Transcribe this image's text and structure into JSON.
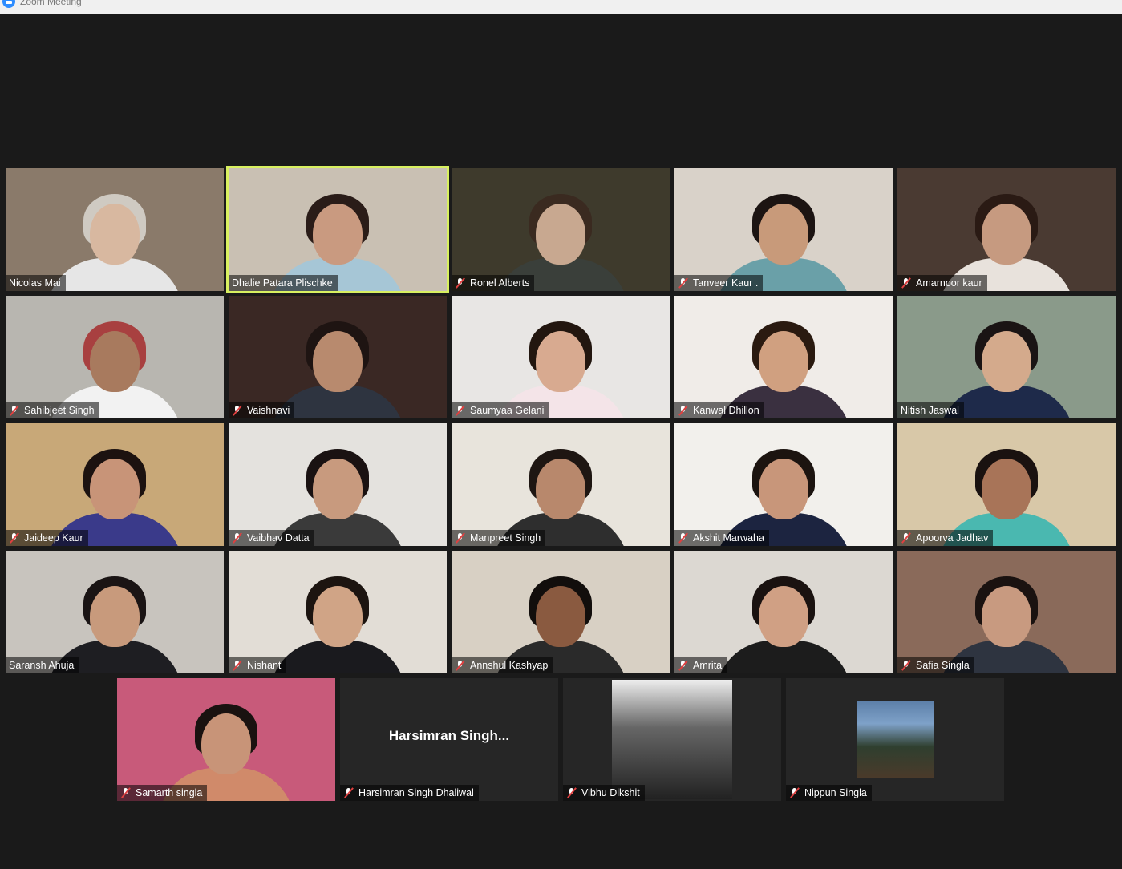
{
  "window": {
    "title": "Zoom Meeting",
    "app_icon": "zoom-icon"
  },
  "participants": [
    {
      "name": "Nicolas Mai",
      "muted": false,
      "bg": "#8a7a6a",
      "skin": "#d8b8a0",
      "hair": "#cfcac2",
      "shirt": "#e6e6e6"
    },
    {
      "name": "Dhalie Patara Plischke",
      "muted": false,
      "active": true,
      "bg": "#c9c0b3",
      "skin": "#c99a80",
      "hair": "#2a1c18",
      "shirt": "#a6c6d6"
    },
    {
      "name": "Ronel Alberts",
      "muted": true,
      "bg": "#3e3a2c",
      "skin": "#c8a890",
      "hair": "#3a2a20",
      "shirt": "#3a3f3a"
    },
    {
      "name": "Tanveer Kaur .",
      "muted": true,
      "bg": "#d9d2c9",
      "skin": "#c89a7a",
      "hair": "#1c1412",
      "shirt": "#6aa0a8"
    },
    {
      "name": "Amarnoor kaur",
      "muted": true,
      "bg": "#4a3a32",
      "skin": "#c69a80",
      "hair": "#2a1a14",
      "shirt": "#e8e2dc"
    },
    {
      "name": "Sahibjeet Singh",
      "muted": true,
      "bg": "#b8b6b0",
      "skin": "#a87a5e",
      "hair": "#a84040",
      "shirt": "#f2f2f2"
    },
    {
      "name": "Vaishnavi",
      "muted": true,
      "bg": "#3a2824",
      "skin": "#b88a6e",
      "hair": "#1e1412",
      "shirt": "#2e3440"
    },
    {
      "name": "Saumyaa Gelani",
      "muted": true,
      "bg": "#e8e6e4",
      "skin": "#d8aa90",
      "hair": "#22160f",
      "shirt": "#f4e4e8"
    },
    {
      "name": "Kanwal Dhillon",
      "muted": true,
      "bg": "#f0ece8",
      "skin": "#d0a080",
      "hair": "#2a1a10",
      "shirt": "#3a3040"
    },
    {
      "name": "Nitish Jaswal",
      "muted": false,
      "bg": "#8a9a8a",
      "skin": "#d4aa8c",
      "hair": "#1a1414",
      "shirt": "#1e2a4a"
    },
    {
      "name": "Jaideep Kaur",
      "muted": true,
      "bg": "#c8a878",
      "skin": "#c89478",
      "hair": "#1c1210",
      "shirt": "#3a3a8a"
    },
    {
      "name": "Vaibhav Datta",
      "muted": true,
      "bg": "#e4e2de",
      "skin": "#c89a7e",
      "hair": "#1a1212",
      "shirt": "#3a3a3a"
    },
    {
      "name": "Manpreet Singh",
      "muted": true,
      "bg": "#e8e4dc",
      "skin": "#b8886c",
      "hair": "#1e1612",
      "shirt": "#2e2e2e"
    },
    {
      "name": "Akshit Marwaha",
      "muted": true,
      "bg": "#f2f0ec",
      "skin": "#c8967a",
      "hair": "#1c1410",
      "shirt": "#1c2440"
    },
    {
      "name": "Apoorva Jadhav",
      "muted": true,
      "bg": "#d8c8a8",
      "skin": "#a87458",
      "hair": "#1a1210",
      "shirt": "#4ab8b0"
    },
    {
      "name": "Saransh Ahuja",
      "muted": false,
      "bg": "#c8c4be",
      "skin": "#c89a7c",
      "hair": "#1a1414",
      "shirt": "#1e1e22"
    },
    {
      "name": "Nishant",
      "muted": true,
      "bg": "#e2ddd6",
      "skin": "#d0a486",
      "hair": "#1c1410",
      "shirt": "#1a1a1e"
    },
    {
      "name": "Annshul Kashyap",
      "muted": true,
      "bg": "#d8d0c4",
      "skin": "#8a5a40",
      "hair": "#120e0c",
      "shirt": "#2a2a2a"
    },
    {
      "name": "Amrita",
      "muted": true,
      "bg": "#dcd8d2",
      "skin": "#d0a084",
      "hair": "#1a1210",
      "shirt": "#1c1c1c"
    },
    {
      "name": "Safia Singla",
      "muted": true,
      "bg": "#8a6a5a",
      "skin": "#c89a80",
      "hair": "#1a1210",
      "shirt": "#2e3440"
    }
  ],
  "bottom_row": [
    {
      "name": "Samarth singla",
      "muted": true,
      "type": "video",
      "bg": "#c85a7a",
      "skin": "#c89478",
      "hair": "#1a1210",
      "shirt": "#d08a6a"
    },
    {
      "name": "Harsimran Singh Dhaliwal",
      "muted": true,
      "type": "text",
      "display_text": "Harsimran  Singh..."
    },
    {
      "name": "Vibhu Dikshit",
      "muted": true,
      "type": "photo"
    },
    {
      "name": "Nippun Singla",
      "muted": true,
      "type": "avatar"
    }
  ]
}
